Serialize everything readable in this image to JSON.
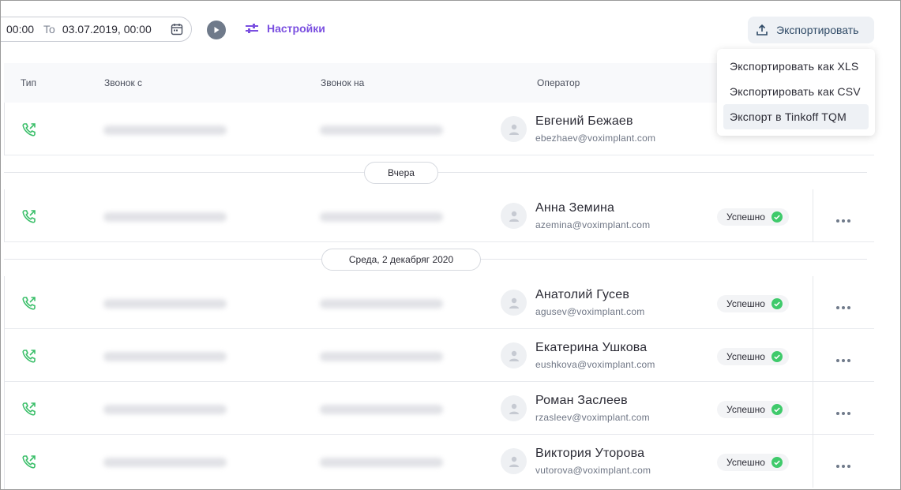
{
  "toolbar": {
    "date_from": "00:00",
    "to_label": "To",
    "date_to": "03.07.2019, 00:00",
    "settings_label": "Настройки",
    "export_label": "Экспортировать"
  },
  "export_menu": {
    "items": [
      "Экспортировать как XLS",
      "Экспортировать как CSV",
      "Экспорт в Tinkoff TQM"
    ],
    "active_index": 2
  },
  "table": {
    "columns": [
      "Тип",
      "Звонок с",
      "Звонок на",
      "Оператор"
    ],
    "rows": [
      {
        "operator": "Евгений Бежаев",
        "email": "ebezhaev@voximplant.com",
        "status": ""
      },
      {
        "operator": "Анна Земина",
        "email": "azemina@voximplant.com",
        "status": "Успешно"
      },
      {
        "operator": "Анатолий Гусев",
        "email": "agusev@voximplant.com",
        "status": "Успешно"
      },
      {
        "operator": "Екатерина Ушкова",
        "email": "eushkova@voximplant.com",
        "status": "Успешно"
      },
      {
        "operator": "Роман Заслеев",
        "email": "rzasleev@voximplant.com",
        "status": "Успешно"
      },
      {
        "operator": "Виктория Уторова",
        "email": "vutorova@voximplant.com",
        "status": "Успешно"
      }
    ],
    "date_groups": [
      "Вчера",
      "Среда, 2 декабряг 2020"
    ]
  },
  "icons": {
    "call_type": "outgoing-call-icon",
    "calendar": "calendar-icon",
    "play": "play-icon",
    "settings": "sliders-icon",
    "export": "upload-icon",
    "avatar": "user-icon",
    "status": "check-circle-icon",
    "more": "more-icon"
  },
  "colors": {
    "accent": "#7a4fe0",
    "call_icon": "#3bbf6a",
    "success": "#3fca6b",
    "export_text": "#2f4a66"
  }
}
